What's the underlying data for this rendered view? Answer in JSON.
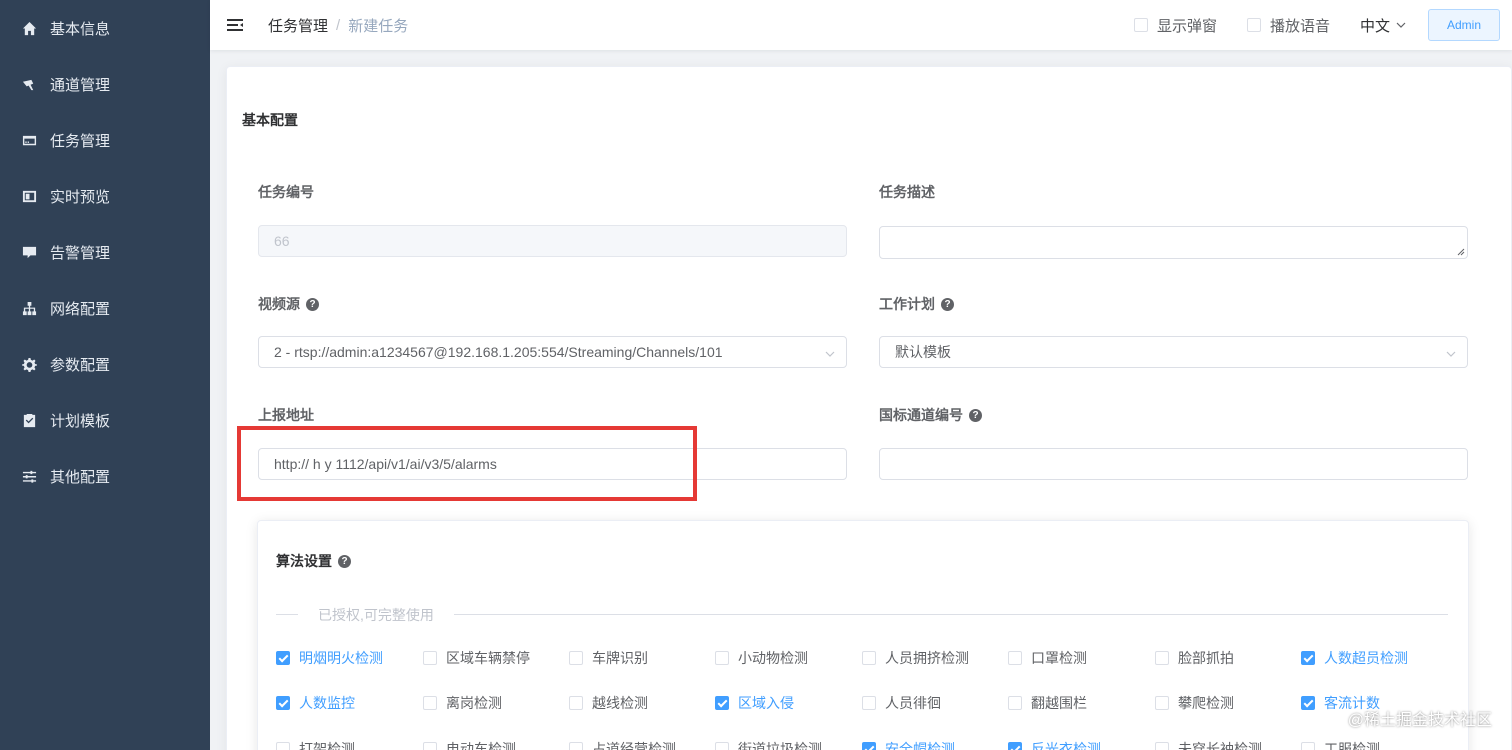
{
  "sidebar": {
    "items": [
      {
        "label": "基本信息",
        "icon": "home-icon"
      },
      {
        "label": "通道管理",
        "icon": "channel-icon"
      },
      {
        "label": "任务管理",
        "icon": "task-icon"
      },
      {
        "label": "实时预览",
        "icon": "preview-icon"
      },
      {
        "label": "告警管理",
        "icon": "alarm-icon"
      },
      {
        "label": "网络配置",
        "icon": "network-icon"
      },
      {
        "label": "参数配置",
        "icon": "gear-icon"
      },
      {
        "label": "计划模板",
        "icon": "clipboard-icon"
      },
      {
        "label": "其他配置",
        "icon": "sliders-icon"
      }
    ]
  },
  "header": {
    "breadcrumb": [
      "任务管理",
      "新建任务"
    ],
    "breadcrumb_sep": "/",
    "show_popup_label": "显示弹窗",
    "play_voice_label": "播放语音",
    "language": "中文",
    "user_button": "Admin"
  },
  "form": {
    "section_title": "基本配置",
    "task_id_label": "任务编号",
    "task_id_value": "66",
    "task_desc_label": "任务描述",
    "task_desc_value": "",
    "video_source_label": "视频源",
    "video_source_value": "2 - rtsp://admin:a1234567@192.168.1.205:554/Streaming/Channels/101",
    "work_plan_label": "工作计划",
    "work_plan_value": "默认模板",
    "report_url_label": "上报地址",
    "report_url_value": "http:// h              y              1112/api/v1/ai/v3/5/alarms",
    "gb_channel_label": "国标通道编号",
    "gb_channel_value": ""
  },
  "algorithms": {
    "title": "算法设置",
    "divider_text": "已授权,可完整使用",
    "rows": [
      [
        {
          "label": "明烟明火检测",
          "checked": true
        },
        {
          "label": "区域车辆禁停",
          "checked": false
        },
        {
          "label": "车牌识别",
          "checked": false
        },
        {
          "label": "小动物检测",
          "checked": false
        },
        {
          "label": "人员拥挤检测",
          "checked": false
        },
        {
          "label": "口罩检测",
          "checked": false
        },
        {
          "label": "脸部抓拍",
          "checked": false
        },
        {
          "label": "人数超员检测",
          "checked": true
        }
      ],
      [
        {
          "label": "人数监控",
          "checked": true
        },
        {
          "label": "离岗检测",
          "checked": false
        },
        {
          "label": "越线检测",
          "checked": false
        },
        {
          "label": "区域入侵",
          "checked": true
        },
        {
          "label": "人员徘徊",
          "checked": false
        },
        {
          "label": "翻越围栏",
          "checked": false
        },
        {
          "label": "攀爬检测",
          "checked": false
        },
        {
          "label": "客流计数",
          "checked": true
        }
      ],
      [
        {
          "label": "打架检测",
          "checked": false
        },
        {
          "label": "电动车检测",
          "checked": false
        },
        {
          "label": "占道经营检测",
          "checked": false
        },
        {
          "label": "街道垃圾检测",
          "checked": false
        },
        {
          "label": "安全帽检测",
          "checked": true
        },
        {
          "label": "反光衣检测",
          "checked": true
        },
        {
          "label": "未穿长袖检测",
          "checked": false
        },
        {
          "label": "工服检测",
          "checked": false
        }
      ]
    ]
  },
  "watermark": "@稀土掘金技术社区"
}
